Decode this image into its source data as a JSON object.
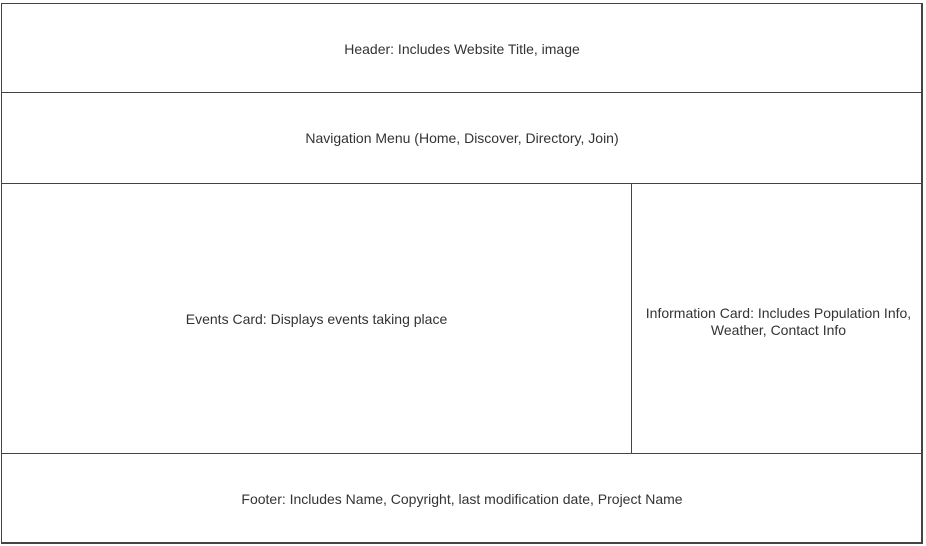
{
  "header": {
    "label": "Header: Includes Website Title, image"
  },
  "navigation": {
    "label": "Navigation Menu (Home, Discover, Directory, Join)"
  },
  "events_card": {
    "label": "Events Card: Displays events taking place"
  },
  "information_card": {
    "label": "Information Card: Includes Population Info,\nWeather, Contact Info"
  },
  "footer": {
    "label": "Footer: Includes Name, Copyright, last modification date, Project Name"
  }
}
